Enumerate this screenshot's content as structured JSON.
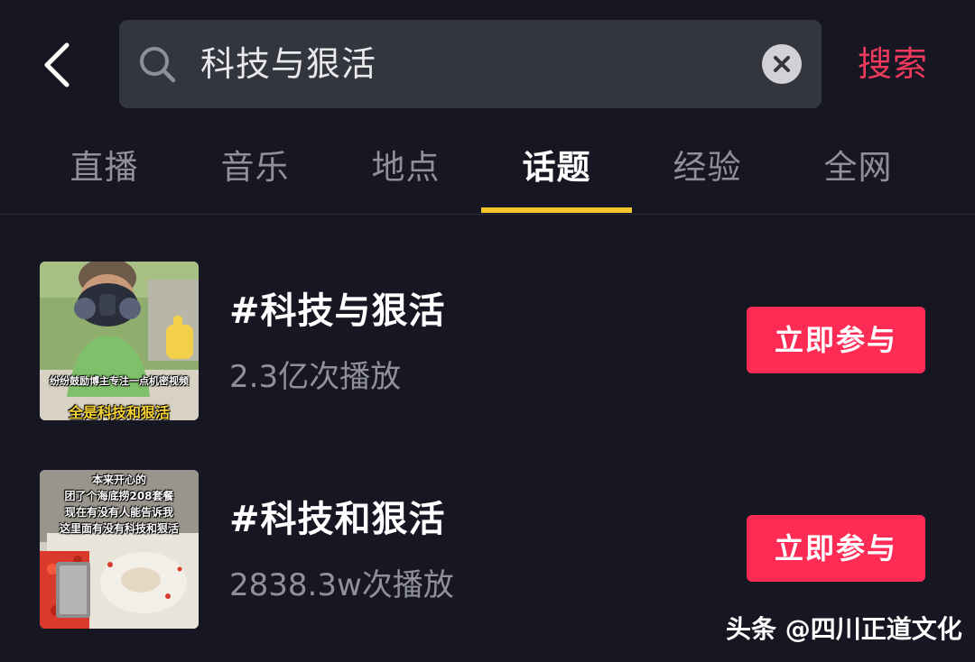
{
  "search": {
    "query": "科技与狠活",
    "submit_label": "搜索"
  },
  "tabs": [
    {
      "label": "直播"
    },
    {
      "label": "音乐"
    },
    {
      "label": "地点"
    },
    {
      "label": "话题",
      "active": true
    },
    {
      "label": "经验"
    },
    {
      "label": "全网"
    }
  ],
  "results": [
    {
      "title": "#科技与狠活",
      "plays": "2.3亿次播放",
      "button_label": "立即参与",
      "thumb_caption_small": "纷纷鼓励博主专注一点机密视频",
      "thumb_caption_big": "全是科技和狠活"
    },
    {
      "title": "#科技和狠活",
      "plays": "2838.3w次播放",
      "button_label": "立即参与",
      "thumb_caption_lines": [
        "本来开心的",
        "团了个海底捞208套餐",
        "现在有没有人能告诉我",
        "这里面有没有科技和狠活"
      ]
    }
  ],
  "watermark": "头条 @四川正道文化",
  "colors": {
    "background": "#161722",
    "accent": "#fe2c55",
    "search_link": "#ef3a5d",
    "tab_indicator": "#f6c52c"
  },
  "icons": [
    "back-chevron-icon",
    "search-icon",
    "clear-icon"
  ]
}
